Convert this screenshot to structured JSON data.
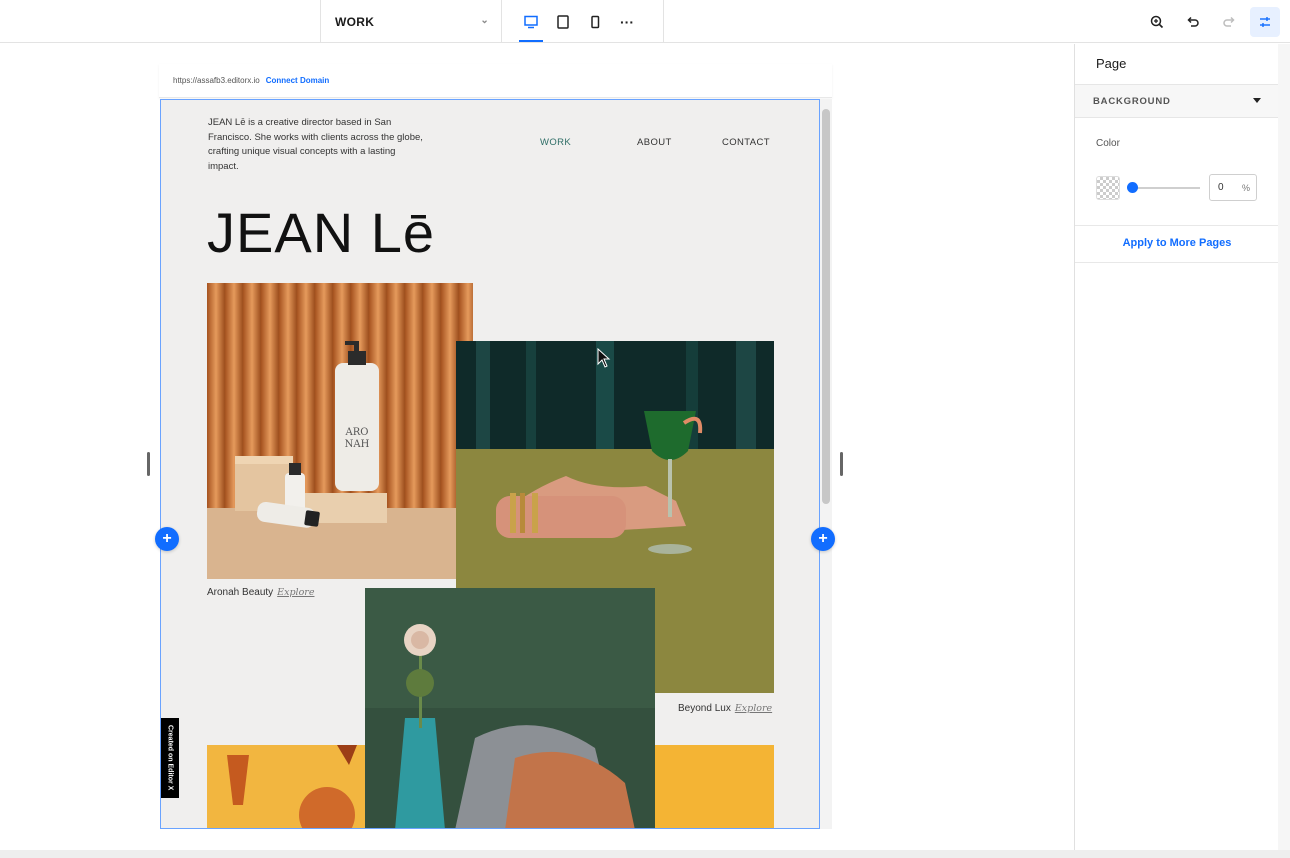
{
  "topbar": {
    "page_select_value": "WORK",
    "device_icons": [
      "desktop-icon",
      "tablet-icon",
      "mobile-icon"
    ],
    "more_label": "···",
    "right_icons": [
      "zoom-icon",
      "undo-icon",
      "redo-icon",
      "adjust-icon"
    ]
  },
  "canvas": {
    "url": "https://assafb3.editorx.io",
    "connect_domain": "Connect Domain"
  },
  "site": {
    "intro": "JEAN Lē is a creative director based in San Francisco. She works with clients across the globe, crafting unique visual concepts with a lasting impact.",
    "nav": [
      "WORK",
      "ABOUT",
      "CONTACT"
    ],
    "title": "JEAN Lē",
    "projects": [
      {
        "name": "Aronah Beauty",
        "explore": "Explore"
      },
      {
        "name": "Beyond Lux",
        "explore": "Explore"
      }
    ],
    "bottle_text": "ARO\nNAH",
    "badge": "Created on Editor X"
  },
  "panel": {
    "title": "Page",
    "section": "BACKGROUND",
    "color_label": "Color",
    "opacity_value": "0",
    "opacity_unit": "%",
    "apply_link": "Apply to More Pages"
  },
  "colors": {
    "accent": "#116dff",
    "site_bg": "#f0efee",
    "nav_active": "#2f6e67"
  }
}
